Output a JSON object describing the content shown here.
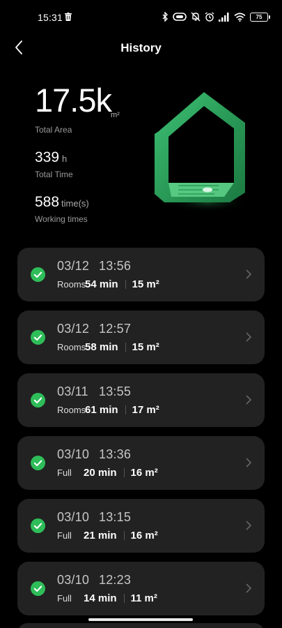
{
  "status_bar": {
    "time": "15:31",
    "battery": "75",
    "icons": [
      "trash-icon",
      "bluetooth-icon",
      "vibrate-icon",
      "mute-bell-icon",
      "alarm-icon",
      "signal-icon",
      "wifi-icon",
      "battery-icon"
    ]
  },
  "header": {
    "title": "History",
    "back_icon": "back-arrow-icon"
  },
  "stats": {
    "total_area_value": "17.5k",
    "total_area_unit": "m²",
    "total_area_label": "Total Area",
    "total_time_value": "339",
    "total_time_unit": "h",
    "total_time_label": "Total Time",
    "working_times_value": "588",
    "working_times_unit": "time(s)",
    "working_times_label": "Working times"
  },
  "colors": {
    "accent_green": "#2ebd59",
    "card_bg": "#222222",
    "background": "#000000"
  },
  "records": [
    {
      "date": "03/12",
      "time": "13:56",
      "mode": "Rooms",
      "duration": "54 min",
      "area": "15 m²"
    },
    {
      "date": "03/12",
      "time": "12:57",
      "mode": "Rooms",
      "duration": "58 min",
      "area": "15 m²"
    },
    {
      "date": "03/11",
      "time": "13:55",
      "mode": "Rooms",
      "duration": "61 min",
      "area": "17 m²"
    },
    {
      "date": "03/10",
      "time": "13:36",
      "mode": "Full",
      "duration": "20 min",
      "area": "16 m²"
    },
    {
      "date": "03/10",
      "time": "13:15",
      "mode": "Full",
      "duration": "21 min",
      "area": "16 m²"
    },
    {
      "date": "03/10",
      "time": "12:23",
      "mode": "Full",
      "duration": "14 min",
      "area": "11 m²"
    }
  ]
}
